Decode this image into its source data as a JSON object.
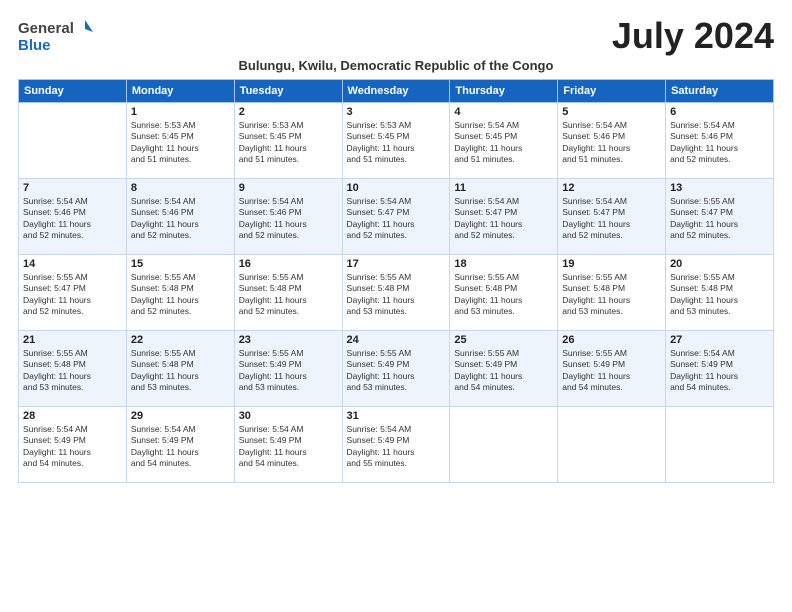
{
  "logo": {
    "general": "General",
    "blue": "Blue"
  },
  "title": "July 2024",
  "subtitle": "Bulungu, Kwilu, Democratic Republic of the Congo",
  "days_of_week": [
    "Sunday",
    "Monday",
    "Tuesday",
    "Wednesday",
    "Thursday",
    "Friday",
    "Saturday"
  ],
  "weeks": [
    [
      {
        "day": "",
        "info": ""
      },
      {
        "day": "1",
        "info": "Sunrise: 5:53 AM\nSunset: 5:45 PM\nDaylight: 11 hours\nand 51 minutes."
      },
      {
        "day": "2",
        "info": "Sunrise: 5:53 AM\nSunset: 5:45 PM\nDaylight: 11 hours\nand 51 minutes."
      },
      {
        "day": "3",
        "info": "Sunrise: 5:53 AM\nSunset: 5:45 PM\nDaylight: 11 hours\nand 51 minutes."
      },
      {
        "day": "4",
        "info": "Sunrise: 5:54 AM\nSunset: 5:45 PM\nDaylight: 11 hours\nand 51 minutes."
      },
      {
        "day": "5",
        "info": "Sunrise: 5:54 AM\nSunset: 5:46 PM\nDaylight: 11 hours\nand 51 minutes."
      },
      {
        "day": "6",
        "info": "Sunrise: 5:54 AM\nSunset: 5:46 PM\nDaylight: 11 hours\nand 52 minutes."
      }
    ],
    [
      {
        "day": "7",
        "info": "Sunrise: 5:54 AM\nSunset: 5:46 PM\nDaylight: 11 hours\nand 52 minutes."
      },
      {
        "day": "8",
        "info": "Sunrise: 5:54 AM\nSunset: 5:46 PM\nDaylight: 11 hours\nand 52 minutes."
      },
      {
        "day": "9",
        "info": "Sunrise: 5:54 AM\nSunset: 5:46 PM\nDaylight: 11 hours\nand 52 minutes."
      },
      {
        "day": "10",
        "info": "Sunrise: 5:54 AM\nSunset: 5:47 PM\nDaylight: 11 hours\nand 52 minutes."
      },
      {
        "day": "11",
        "info": "Sunrise: 5:54 AM\nSunset: 5:47 PM\nDaylight: 11 hours\nand 52 minutes."
      },
      {
        "day": "12",
        "info": "Sunrise: 5:54 AM\nSunset: 5:47 PM\nDaylight: 11 hours\nand 52 minutes."
      },
      {
        "day": "13",
        "info": "Sunrise: 5:55 AM\nSunset: 5:47 PM\nDaylight: 11 hours\nand 52 minutes."
      }
    ],
    [
      {
        "day": "14",
        "info": "Sunrise: 5:55 AM\nSunset: 5:47 PM\nDaylight: 11 hours\nand 52 minutes."
      },
      {
        "day": "15",
        "info": "Sunrise: 5:55 AM\nSunset: 5:48 PM\nDaylight: 11 hours\nand 52 minutes."
      },
      {
        "day": "16",
        "info": "Sunrise: 5:55 AM\nSunset: 5:48 PM\nDaylight: 11 hours\nand 52 minutes."
      },
      {
        "day": "17",
        "info": "Sunrise: 5:55 AM\nSunset: 5:48 PM\nDaylight: 11 hours\nand 53 minutes."
      },
      {
        "day": "18",
        "info": "Sunrise: 5:55 AM\nSunset: 5:48 PM\nDaylight: 11 hours\nand 53 minutes."
      },
      {
        "day": "19",
        "info": "Sunrise: 5:55 AM\nSunset: 5:48 PM\nDaylight: 11 hours\nand 53 minutes."
      },
      {
        "day": "20",
        "info": "Sunrise: 5:55 AM\nSunset: 5:48 PM\nDaylight: 11 hours\nand 53 minutes."
      }
    ],
    [
      {
        "day": "21",
        "info": "Sunrise: 5:55 AM\nSunset: 5:48 PM\nDaylight: 11 hours\nand 53 minutes."
      },
      {
        "day": "22",
        "info": "Sunrise: 5:55 AM\nSunset: 5:48 PM\nDaylight: 11 hours\nand 53 minutes."
      },
      {
        "day": "23",
        "info": "Sunrise: 5:55 AM\nSunset: 5:49 PM\nDaylight: 11 hours\nand 53 minutes."
      },
      {
        "day": "24",
        "info": "Sunrise: 5:55 AM\nSunset: 5:49 PM\nDaylight: 11 hours\nand 53 minutes."
      },
      {
        "day": "25",
        "info": "Sunrise: 5:55 AM\nSunset: 5:49 PM\nDaylight: 11 hours\nand 54 minutes."
      },
      {
        "day": "26",
        "info": "Sunrise: 5:55 AM\nSunset: 5:49 PM\nDaylight: 11 hours\nand 54 minutes."
      },
      {
        "day": "27",
        "info": "Sunrise: 5:54 AM\nSunset: 5:49 PM\nDaylight: 11 hours\nand 54 minutes."
      }
    ],
    [
      {
        "day": "28",
        "info": "Sunrise: 5:54 AM\nSunset: 5:49 PM\nDaylight: 11 hours\nand 54 minutes."
      },
      {
        "day": "29",
        "info": "Sunrise: 5:54 AM\nSunset: 5:49 PM\nDaylight: 11 hours\nand 54 minutes."
      },
      {
        "day": "30",
        "info": "Sunrise: 5:54 AM\nSunset: 5:49 PM\nDaylight: 11 hours\nand 54 minutes."
      },
      {
        "day": "31",
        "info": "Sunrise: 5:54 AM\nSunset: 5:49 PM\nDaylight: 11 hours\nand 55 minutes."
      },
      {
        "day": "",
        "info": ""
      },
      {
        "day": "",
        "info": ""
      },
      {
        "day": "",
        "info": ""
      }
    ]
  ]
}
